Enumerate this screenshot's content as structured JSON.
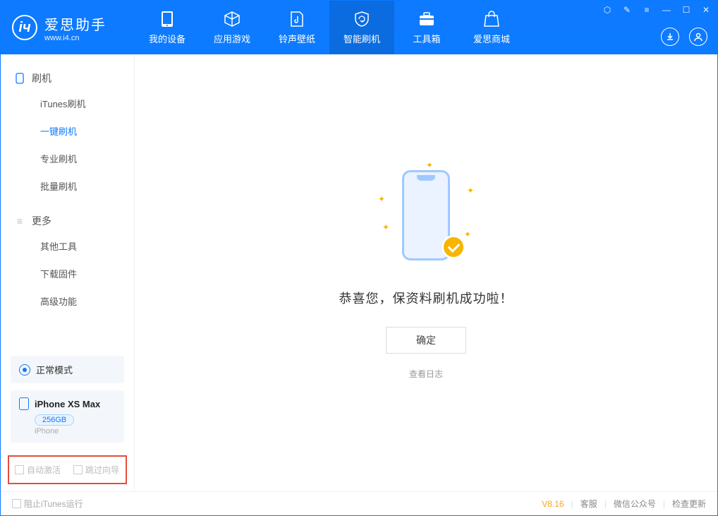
{
  "app": {
    "title": "爱思助手",
    "subtitle": "www.i4.cn"
  },
  "nav": {
    "items": [
      {
        "label": "我的设备"
      },
      {
        "label": "应用游戏"
      },
      {
        "label": "铃声壁纸"
      },
      {
        "label": "智能刷机"
      },
      {
        "label": "工具箱"
      },
      {
        "label": "爱思商城"
      }
    ]
  },
  "sidebar": {
    "group_flash": "刷机",
    "items_flash": [
      {
        "label": "iTunes刷机"
      },
      {
        "label": "一键刷机"
      },
      {
        "label": "专业刷机"
      },
      {
        "label": "批量刷机"
      }
    ],
    "group_more": "更多",
    "items_more": [
      {
        "label": "其他工具"
      },
      {
        "label": "下载固件"
      },
      {
        "label": "高级功能"
      }
    ]
  },
  "device": {
    "mode": "正常模式",
    "name": "iPhone XS Max",
    "storage": "256GB",
    "type": "iPhone"
  },
  "options": {
    "auto_activate": "自动激活",
    "skip_guide": "跳过向导"
  },
  "main": {
    "message": "恭喜您，保资料刷机成功啦！",
    "confirm": "确定",
    "view_log": "查看日志"
  },
  "status": {
    "block_itunes": "阻止iTunes运行",
    "version": "V8.16",
    "links": [
      "客服",
      "微信公众号",
      "检查更新"
    ]
  }
}
